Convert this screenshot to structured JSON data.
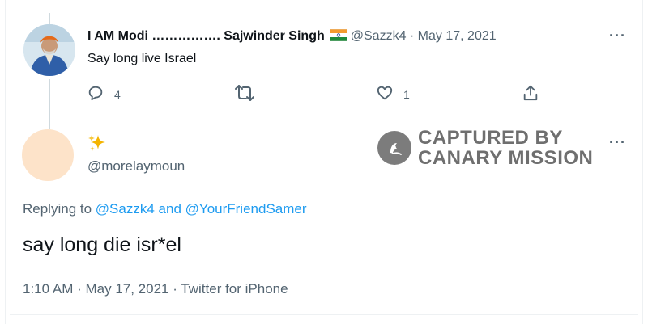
{
  "tweet1": {
    "display_name": "I AM Modi ……………. Sajwinder Singh",
    "flag_icon": "india-flag-icon",
    "handle_date": "@Sazzk4 · May 17, 2021",
    "text": "Say long live Israel",
    "reply_count": "4",
    "like_count": "1"
  },
  "tweet2": {
    "emoji": "✨",
    "handle": "@morelaymoun",
    "replying_prefix": "Replying to",
    "replying_user1": "@Sazzk4",
    "replying_and": "and",
    "replying_user2": "@YourFriendSamer",
    "text": "say long die isr*el",
    "meta": "1:10 AM · May 17, 2021 · Twitter for iPhone"
  },
  "watermark": {
    "line1": "CAPTURED BY",
    "line2": "CANARY MISSION"
  },
  "more_label": "···",
  "colors": {
    "text": "#0f1419",
    "muted": "#536471",
    "link": "#1d9bf0",
    "watermark": "#6f6f6f"
  }
}
